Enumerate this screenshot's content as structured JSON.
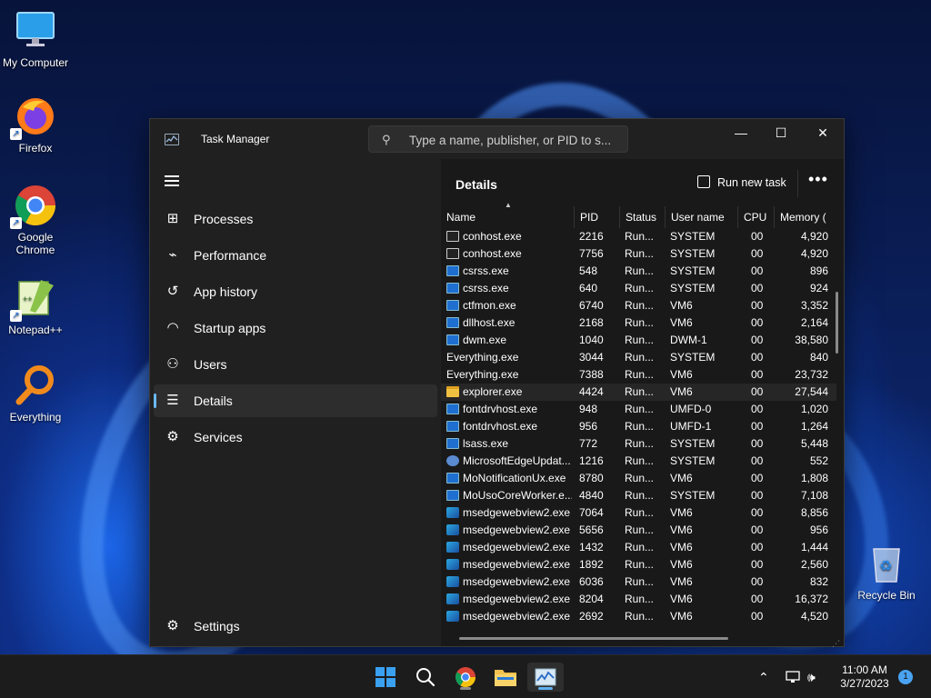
{
  "desktop": {
    "icons": [
      {
        "label": "My Computer",
        "icon": "monitor-icon"
      },
      {
        "label": "Firefox",
        "icon": "firefox-icon"
      },
      {
        "label": "Google Chrome",
        "icon": "chrome-icon"
      },
      {
        "label": "Notepad++",
        "icon": "notepadpp-icon"
      },
      {
        "label": "Everything",
        "icon": "everything-icon"
      },
      {
        "label": "Recycle Bin",
        "icon": "recycle-bin-icon"
      }
    ]
  },
  "window": {
    "title": "Task Manager",
    "search_placeholder": "Type a name, publisher, or PID to s...",
    "controls": {
      "minimize": "—",
      "maximize": "☐",
      "close": "✕"
    }
  },
  "sidebar": {
    "items": [
      {
        "label": "Processes",
        "icon": "processes-icon"
      },
      {
        "label": "Performance",
        "icon": "performance-icon"
      },
      {
        "label": "App history",
        "icon": "app-history-icon"
      },
      {
        "label": "Startup apps",
        "icon": "startup-apps-icon"
      },
      {
        "label": "Users",
        "icon": "users-icon"
      },
      {
        "label": "Details",
        "icon": "details-icon",
        "active": true
      },
      {
        "label": "Services",
        "icon": "services-icon"
      }
    ],
    "settings_label": "Settings"
  },
  "details": {
    "title": "Details",
    "run_new_task": "Run new task",
    "more": "•••",
    "columns": [
      "Name",
      "PID",
      "Status",
      "User name",
      "CPU",
      "Memory ("
    ],
    "rows": [
      {
        "icon": "console",
        "name": "conhost.exe",
        "pid": "2216",
        "status": "Run...",
        "user": "SYSTEM",
        "cpu": "00",
        "mem": "4,920"
      },
      {
        "icon": "console",
        "name": "conhost.exe",
        "pid": "7756",
        "status": "Run...",
        "user": "SYSTEM",
        "cpu": "00",
        "mem": "4,920"
      },
      {
        "icon": "window",
        "name": "csrss.exe",
        "pid": "548",
        "status": "Run...",
        "user": "SYSTEM",
        "cpu": "00",
        "mem": "896"
      },
      {
        "icon": "window",
        "name": "csrss.exe",
        "pid": "640",
        "status": "Run...",
        "user": "SYSTEM",
        "cpu": "00",
        "mem": "924"
      },
      {
        "icon": "window",
        "name": "ctfmon.exe",
        "pid": "6740",
        "status": "Run...",
        "user": "VM6",
        "cpu": "00",
        "mem": "3,352"
      },
      {
        "icon": "window",
        "name": "dllhost.exe",
        "pid": "2168",
        "status": "Run...",
        "user": "VM6",
        "cpu": "00",
        "mem": "2,164"
      },
      {
        "icon": "window",
        "name": "dwm.exe",
        "pid": "1040",
        "status": "Run...",
        "user": "DWM-1",
        "cpu": "00",
        "mem": "38,580"
      },
      {
        "icon": "search",
        "name": "Everything.exe",
        "pid": "3044",
        "status": "Run...",
        "user": "SYSTEM",
        "cpu": "00",
        "mem": "840"
      },
      {
        "icon": "search",
        "name": "Everything.exe",
        "pid": "7388",
        "status": "Run...",
        "user": "VM6",
        "cpu": "00",
        "mem": "23,732"
      },
      {
        "icon": "folder",
        "name": "explorer.exe",
        "pid": "4424",
        "status": "Run...",
        "user": "VM6",
        "cpu": "00",
        "mem": "27,544",
        "highlight": true
      },
      {
        "icon": "window",
        "name": "fontdrvhost.exe",
        "pid": "948",
        "status": "Run...",
        "user": "UMFD-0",
        "cpu": "00",
        "mem": "1,020"
      },
      {
        "icon": "window",
        "name": "fontdrvhost.exe",
        "pid": "956",
        "status": "Run...",
        "user": "UMFD-1",
        "cpu": "00",
        "mem": "1,264"
      },
      {
        "icon": "window",
        "name": "lsass.exe",
        "pid": "772",
        "status": "Run...",
        "user": "SYSTEM",
        "cpu": "00",
        "mem": "5,448"
      },
      {
        "icon": "gear",
        "name": "MicrosoftEdgeUpdat...",
        "pid": "1216",
        "status": "Run...",
        "user": "SYSTEM",
        "cpu": "00",
        "mem": "552"
      },
      {
        "icon": "window",
        "name": "MoNotificationUx.exe",
        "pid": "8780",
        "status": "Run...",
        "user": "VM6",
        "cpu": "00",
        "mem": "1,808"
      },
      {
        "icon": "window",
        "name": "MoUsoCoreWorker.e...",
        "pid": "4840",
        "status": "Run...",
        "user": "SYSTEM",
        "cpu": "00",
        "mem": "7,108"
      },
      {
        "icon": "edge",
        "name": "msedgewebview2.exe",
        "pid": "7064",
        "status": "Run...",
        "user": "VM6",
        "cpu": "00",
        "mem": "8,856"
      },
      {
        "icon": "edge",
        "name": "msedgewebview2.exe",
        "pid": "5656",
        "status": "Run...",
        "user": "VM6",
        "cpu": "00",
        "mem": "956"
      },
      {
        "icon": "edge",
        "name": "msedgewebview2.exe",
        "pid": "1432",
        "status": "Run...",
        "user": "VM6",
        "cpu": "00",
        "mem": "1,444"
      },
      {
        "icon": "edge",
        "name": "msedgewebview2.exe",
        "pid": "1892",
        "status": "Run...",
        "user": "VM6",
        "cpu": "00",
        "mem": "2,560"
      },
      {
        "icon": "edge",
        "name": "msedgewebview2.exe",
        "pid": "6036",
        "status": "Run...",
        "user": "VM6",
        "cpu": "00",
        "mem": "832"
      },
      {
        "icon": "edge",
        "name": "msedgewebview2.exe",
        "pid": "8204",
        "status": "Run...",
        "user": "VM6",
        "cpu": "00",
        "mem": "16,372"
      },
      {
        "icon": "edge",
        "name": "msedgewebview2.exe",
        "pid": "2692",
        "status": "Run...",
        "user": "VM6",
        "cpu": "00",
        "mem": "4,520"
      }
    ]
  },
  "taskbar": {
    "items": [
      {
        "icon": "start-icon"
      },
      {
        "icon": "search-icon"
      },
      {
        "icon": "chrome-icon"
      },
      {
        "icon": "file-explorer-icon"
      },
      {
        "icon": "task-manager-icon",
        "active": true
      }
    ],
    "tray": {
      "time": "11:00 AM",
      "date": "3/27/2023",
      "notifications": "1"
    }
  },
  "colors": {
    "accent": "#6cb8f6",
    "window_bg": "#202020",
    "content_bg": "#191919"
  }
}
